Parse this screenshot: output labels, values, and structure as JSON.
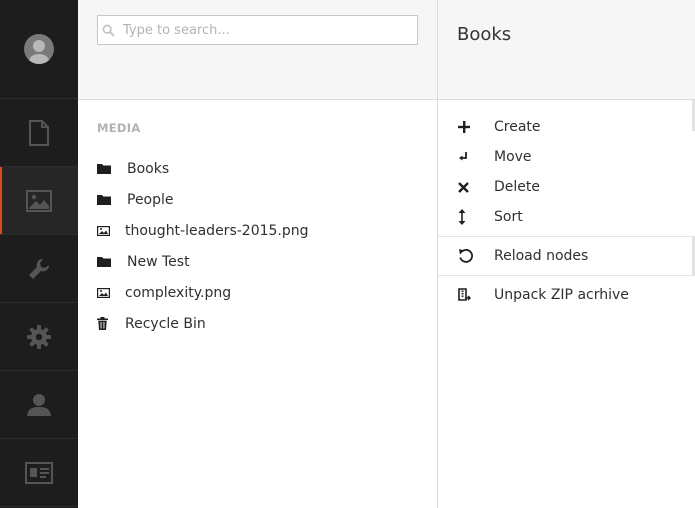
{
  "sidebar": {
    "items": [
      {
        "icon": "document-icon",
        "name": "rail-item-content"
      },
      {
        "icon": "image-icon",
        "name": "rail-item-media",
        "active": true
      },
      {
        "icon": "wrench-icon",
        "name": "rail-item-developer"
      },
      {
        "icon": "gear-icon",
        "name": "rail-item-settings"
      },
      {
        "icon": "user-icon",
        "name": "rail-item-users"
      },
      {
        "icon": "id-card-icon",
        "name": "rail-item-members"
      }
    ],
    "accent_color": "#da4a22"
  },
  "search": {
    "placeholder": "Type to search..."
  },
  "tree": {
    "section_label": "MEDIA",
    "items": [
      {
        "label": "Books",
        "icon": "folder-icon"
      },
      {
        "label": "People",
        "icon": "folder-icon"
      },
      {
        "label": "thought-leaders-2015.png",
        "icon": "image-icon"
      },
      {
        "label": "New Test",
        "icon": "folder-icon"
      },
      {
        "label": "complexity.png",
        "icon": "image-icon"
      },
      {
        "label": "Recycle Bin",
        "icon": "trash-icon"
      }
    ]
  },
  "actions": {
    "title": "Books",
    "groups": [
      [
        {
          "label": "Create",
          "icon": "plus-icon"
        },
        {
          "label": "Move",
          "icon": "move-arrow-icon"
        },
        {
          "label": "Delete",
          "icon": "close-icon"
        },
        {
          "label": "Sort",
          "icon": "sort-arrows-icon"
        }
      ],
      [
        {
          "label": "Reload nodes",
          "icon": "reload-icon"
        }
      ],
      [
        {
          "label": "Unpack ZIP acrhive",
          "icon": "zip-icon"
        }
      ]
    ]
  }
}
